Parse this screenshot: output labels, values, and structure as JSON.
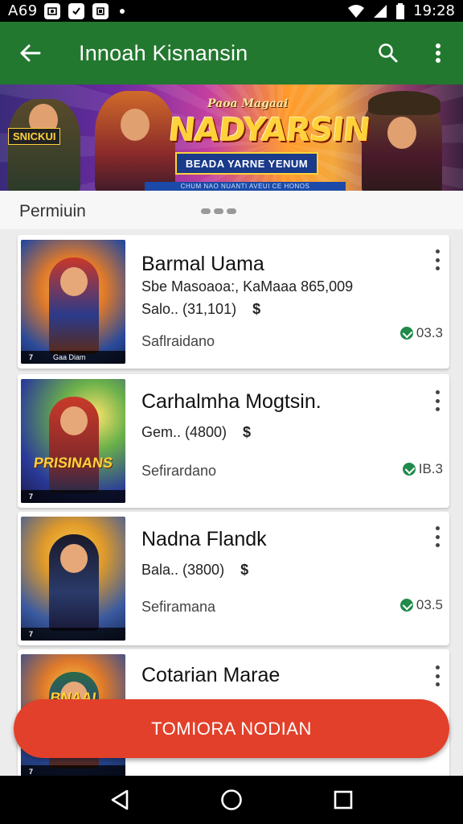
{
  "status_bar": {
    "left_text": "A69",
    "time": "19:28"
  },
  "app_bar": {
    "title": "Innoah Kisnansin"
  },
  "banner": {
    "logo_small": "Paoa Magaai",
    "logo": "NADYARSIN",
    "ribbon": "BEADA YARNE YENUM",
    "left_tag": "SNICKUI",
    "strip": "CHUM NAO NUANTI AVEUI CE HONOS"
  },
  "section": {
    "title": "Permiuin"
  },
  "games": [
    {
      "title": "Barmal Uama",
      "subtitle": "Sbe Masoaoa:, KaMaaa 865,009",
      "meta": "Salo.. (31,101)",
      "coin": "$",
      "footer": "Saflraidano",
      "rating": "03.3",
      "thumb_label": ""
    },
    {
      "title": "Carhalmha Mogtsin.",
      "subtitle": "",
      "meta": "Gem.. (4800)",
      "coin": "$",
      "footer": "Sefirardano",
      "rating": "IB.3",
      "thumb_label": "PRISINANS"
    },
    {
      "title": "Nadna Flandk",
      "subtitle": "",
      "meta": "Bala.. (3800)",
      "coin": "$",
      "footer": "Sefiramana",
      "rating": "03.5",
      "thumb_label": ""
    },
    {
      "title": "Cotarian Marae",
      "subtitle": "",
      "meta": "",
      "coin": "",
      "footer": "",
      "rating": "",
      "thumb_label": "BNAAI"
    }
  ],
  "fab": {
    "label": "TOMIORA NODIAN"
  },
  "colors": {
    "app_bar": "#23782f",
    "fab": "#e2402a",
    "rating_icon": "#1f8a4a"
  }
}
